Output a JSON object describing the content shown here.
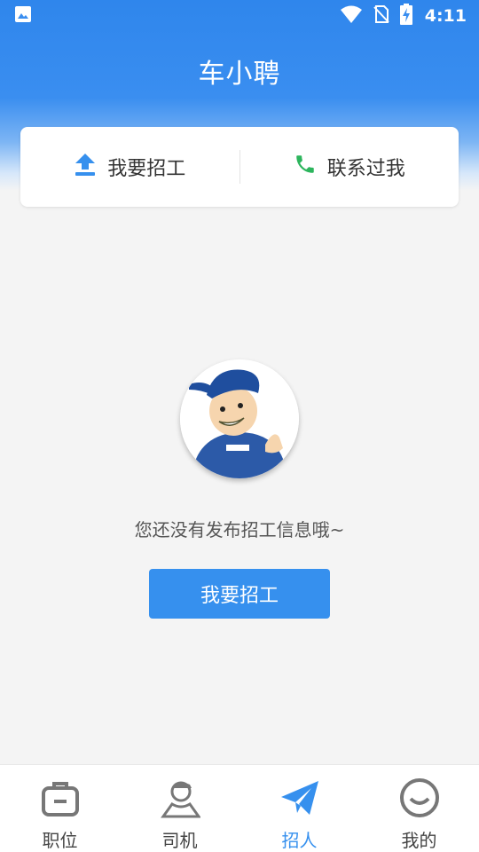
{
  "status_bar": {
    "time": "4:11"
  },
  "header": {
    "title": "车小聘"
  },
  "actions": [
    {
      "label": "我要招工",
      "icon": "upload-icon"
    },
    {
      "label": "联系过我",
      "icon": "phone-icon"
    }
  ],
  "empty_state": {
    "message": "您还没有发布招工信息哦~",
    "button_label": "我要招工"
  },
  "bottom_nav": [
    {
      "label": "职位",
      "icon": "briefcase-icon",
      "active": false
    },
    {
      "label": "司机",
      "icon": "driver-icon",
      "active": false
    },
    {
      "label": "招人",
      "icon": "paper-plane-icon",
      "active": true
    },
    {
      "label": "我的",
      "icon": "smiley-icon",
      "active": false
    }
  ],
  "colors": {
    "accent": "#3690ee",
    "phone": "#2db55d",
    "header": "#2f86ec"
  }
}
